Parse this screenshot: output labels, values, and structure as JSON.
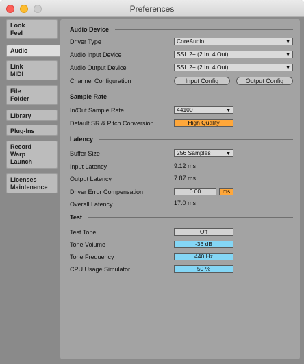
{
  "window": {
    "title": "Preferences"
  },
  "sidebar": {
    "tabs": [
      {
        "label": "Look\nFeel"
      },
      {
        "label": "Audio"
      },
      {
        "label": "Link\nMIDI"
      },
      {
        "label": "File\nFolder"
      },
      {
        "label": "Library"
      },
      {
        "label": "Plug-Ins"
      },
      {
        "label": "Record\nWarp\nLaunch"
      },
      {
        "label": "Licenses\nMaintenance"
      }
    ],
    "active_tab": "Audio"
  },
  "audio_device": {
    "heading": "Audio Device",
    "driver_type_label": "Driver Type",
    "driver_type_value": "CoreAudio",
    "input_device_label": "Audio Input Device",
    "input_device_value": "SSL 2+ (2 In, 4 Out)",
    "output_device_label": "Audio Output Device",
    "output_device_value": "SSL 2+ (2 In, 4 Out)",
    "channel_config_label": "Channel Configuration",
    "input_config_button": "Input Config",
    "output_config_button": "Output Config"
  },
  "sample_rate": {
    "heading": "Sample Rate",
    "rate_label": "In/Out Sample Rate",
    "rate_value": "44100",
    "conversion_label": "Default SR & Pitch Conversion",
    "conversion_value": "High Quality"
  },
  "latency": {
    "heading": "Latency",
    "buffer_label": "Buffer Size",
    "buffer_value": "256 Samples",
    "input_latency_label": "Input Latency",
    "input_latency_value": "9.12 ms",
    "output_latency_label": "Output Latency",
    "output_latency_value": "7.87 ms",
    "compensation_label": "Driver Error Compensation",
    "compensation_value": "0.00",
    "compensation_unit": "ms",
    "overall_label": "Overall Latency",
    "overall_value": "17.0 ms"
  },
  "test": {
    "heading": "Test",
    "tone_label": "Test Tone",
    "tone_value": "Off",
    "volume_label": "Tone Volume",
    "volume_value": "-36 dB",
    "frequency_label": "Tone Frequency",
    "frequency_value": "440 Hz",
    "cpu_label": "CPU Usage Simulator",
    "cpu_value": "50 %"
  },
  "colors": {
    "accent_orange": "#ffa73a",
    "value_blue": "#84d6f5",
    "panel": "#a3a3a3",
    "background": "#8a8a8a"
  },
  "icons": [
    "close-icon",
    "minimize-icon",
    "zoom-icon",
    "dropdown-arrow-icon"
  ]
}
